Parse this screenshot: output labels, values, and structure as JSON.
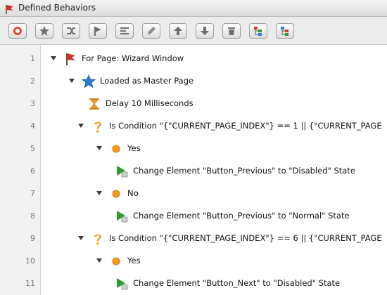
{
  "window": {
    "title": "Defined Behaviors"
  },
  "toolbar": {
    "buttons": [
      {
        "name": "add-event-button",
        "icon": "add-event-icon"
      },
      {
        "name": "add-action-button",
        "icon": "star-icon"
      },
      {
        "name": "add-condition-button",
        "icon": "branch-icon"
      },
      {
        "name": "add-flag-button",
        "icon": "flag-icon"
      },
      {
        "name": "align-button",
        "icon": "align-icon"
      },
      {
        "name": "edit-button",
        "icon": "pencil-icon"
      },
      {
        "name": "move-up-button",
        "icon": "arrow-up-icon"
      },
      {
        "name": "move-down-button",
        "icon": "arrow-down-icon"
      },
      {
        "name": "delete-button",
        "icon": "trash-icon"
      },
      {
        "name": "expand-all-button",
        "icon": "tree-expand-icon"
      },
      {
        "name": "collapse-all-button",
        "icon": "tree-collapse-icon"
      }
    ]
  },
  "rows": [
    {
      "num": "1",
      "label": "For Page: Wizard Window",
      "icon": "page-flag-icon",
      "indent": 0,
      "expander": true
    },
    {
      "num": "2",
      "label": "Loaded as Master Page",
      "icon": "star-event-icon",
      "indent": 1,
      "expander": true
    },
    {
      "num": "3",
      "label": "Delay 10 Milliseconds",
      "icon": "hourglass-icon",
      "indent": 2,
      "expander": false
    },
    {
      "num": "4",
      "label": "Is Condition \"{\"CURRENT_PAGE_INDEX\"} == 1 || {\"CURRENT_PAGE",
      "icon": "question-icon",
      "indent": 1.5,
      "expander": true
    },
    {
      "num": "5",
      "label": "Yes",
      "icon": "branch-dot-icon",
      "indent": 2.5,
      "expander": true
    },
    {
      "num": "6",
      "label": "Change Element \"Button_Previous\" to \"Disabled\" State",
      "icon": "change-state-icon",
      "indent": 3.5,
      "expander": false
    },
    {
      "num": "7",
      "label": "No",
      "icon": "branch-dot-icon",
      "indent": 2.5,
      "expander": true
    },
    {
      "num": "8",
      "label": "Change Element \"Button_Previous\" to \"Normal\" State",
      "icon": "change-state-icon",
      "indent": 3.5,
      "expander": false
    },
    {
      "num": "9",
      "label": "Is Condition \"{\"CURRENT_PAGE_INDEX\"} == 6 || {\"CURRENT_PAGE",
      "icon": "question-icon",
      "indent": 1.5,
      "expander": true
    },
    {
      "num": "10",
      "label": "Yes",
      "icon": "branch-dot-icon",
      "indent": 2.5,
      "expander": true
    },
    {
      "num": "11",
      "label": "Change Element \"Button_Next\" to \"Disabled\" State",
      "icon": "change-state-icon",
      "indent": 3.5,
      "expander": false
    }
  ],
  "colors": {
    "accent_orange": "#f39a1c",
    "star_blue": "#2f7bd8",
    "flag_red": "#c8332b",
    "state_green": "#2e9a2e"
  }
}
